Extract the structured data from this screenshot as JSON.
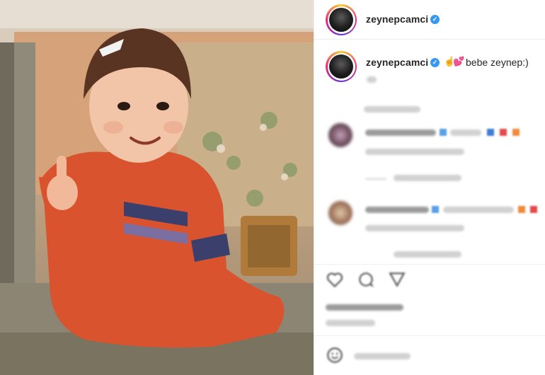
{
  "post": {
    "username": "zeynepcamci",
    "caption": "bebe zeynep:)",
    "caption_emojis": [
      "☝",
      "💕"
    ]
  },
  "icons": {
    "verified": "verified-badge-icon",
    "like": "heart-icon",
    "comment": "comment-icon",
    "share": "share-icon",
    "emoji": "smiley-icon"
  },
  "colors": {
    "verified": "#3897f0",
    "text": "#262626",
    "ring_start": "#f9ce34",
    "ring_mid": "#ee2a7b",
    "ring_end": "#6228d7"
  }
}
